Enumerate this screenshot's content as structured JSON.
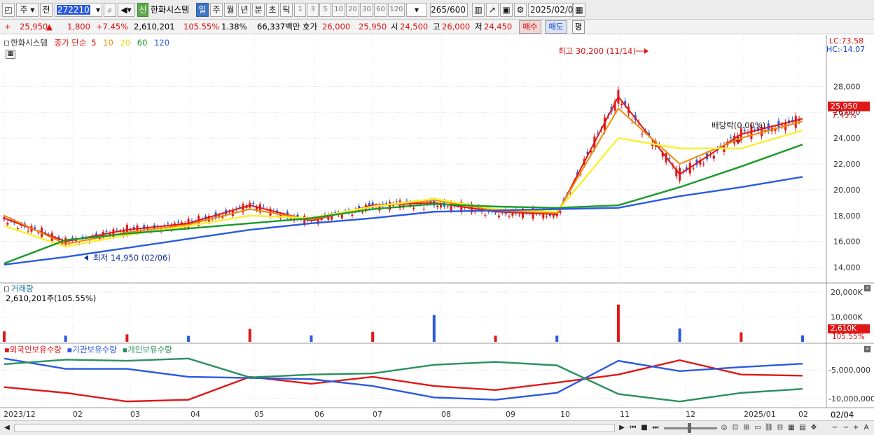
{
  "toolbar": {
    "market_type": "주",
    "market_scope": "전",
    "code": "272210",
    "stock_name": "한화시스템",
    "period_tabs": [
      "일",
      "주",
      "월",
      "년",
      "분",
      "초",
      "틱"
    ],
    "active_period": "일",
    "intervals": [
      "1",
      "3",
      "5",
      "10",
      "20",
      "30",
      "60",
      "120"
    ],
    "count": "265",
    "count_max": "/600",
    "date": "2025/02/04",
    "new_badge": "신"
  },
  "quote": {
    "price": "25,950",
    "price_arrow": "▲",
    "change": "1,800",
    "change_pct": "+7.45%",
    "volume": "2,610,201",
    "volume_ratio": "105.55%",
    "turnover": "1.38%",
    "amount": "66,337백만",
    "ask_label": "호가",
    "ask1": "26,000",
    "ask2": "25,950",
    "open_label": "시",
    "open": "24,500",
    "high_label": "고",
    "high": "26,000",
    "low_label": "저",
    "low": "24,450",
    "buy_button": "매수",
    "sell_button": "매도",
    "eval_button": "평"
  },
  "price_panel": {
    "stock_label": "한화시스템",
    "ma_label": "종가 단순",
    "ma_periods": [
      "5",
      "10",
      "20",
      "60",
      "120"
    ],
    "ma_colors": [
      "#e01818",
      "#f08a00",
      "#f8f030",
      "#1a9a2a",
      "#2a5ae0"
    ],
    "lc": "LC:73.58",
    "hc": "HC:-14.07",
    "high_marker": "최고 30,200 (11/14)",
    "low_marker": "최저 14,950 (02/06)",
    "dividend_marker": "배당락(0.00%)",
    "last_price_tag": "25,950",
    "last_pct_tag": "7.45%"
  },
  "volume_panel": {
    "title": "거래량",
    "value_text": "2,610,201주(105.55%)",
    "last_tag": "2,610K",
    "last_pct": "105.55%"
  },
  "holding_panel": {
    "series": [
      {
        "name": "외국인보유수량",
        "color": "#e01818"
      },
      {
        "name": "기관보유수량",
        "color": "#2a5ae0"
      },
      {
        "name": "개인보유수량",
        "color": "#2a9060"
      }
    ]
  },
  "x_axis": {
    "labels": [
      "2023/12",
      "02",
      "03",
      "04",
      "05",
      "06",
      "07",
      "08",
      "09",
      "10",
      "11",
      "12",
      "2025/01",
      "02"
    ],
    "right_label": "02/04"
  },
  "chart_data": [
    {
      "type": "line",
      "title": "한화시스템",
      "ylim": [
        13000,
        31000
      ],
      "y_ticks": [
        14000,
        16000,
        18000,
        20000,
        22000,
        24000,
        26000,
        28000
      ],
      "y_tick_labels": [
        "14,000",
        "16,000",
        "18,000",
        "20,000",
        "22,000",
        "24,000",
        "26,000",
        "28,000"
      ],
      "x": [
        "2023/12",
        "02",
        "03",
        "04",
        "05",
        "06",
        "07",
        "08",
        "09",
        "10",
        "11",
        "12",
        "2025/01",
        "02"
      ],
      "series": [
        {
          "name": "5",
          "values": [
            17800,
            16000,
            16900,
            17400,
            18800,
            17600,
            18800,
            19000,
            18300,
            18100,
            27200,
            21200,
            24300,
            25500
          ]
        },
        {
          "name": "10",
          "values": [
            18000,
            15800,
            16700,
            17300,
            18500,
            17700,
            18700,
            19200,
            18400,
            18200,
            26300,
            22000,
            24000,
            25300
          ]
        },
        {
          "name": "20",
          "values": [
            17200,
            15600,
            16500,
            17200,
            18000,
            17800,
            18700,
            19300,
            18500,
            18300,
            24000,
            23200,
            23200,
            24600
          ]
        },
        {
          "name": "60",
          "values": [
            14300,
            16100,
            16600,
            17000,
            17400,
            17800,
            18500,
            18900,
            18700,
            18600,
            18800,
            20200,
            21800,
            23500
          ]
        },
        {
          "name": "120",
          "values": [
            14200,
            14800,
            15500,
            16200,
            16900,
            17400,
            17800,
            18300,
            18400,
            18500,
            18600,
            19500,
            20200,
            21000
          ]
        }
      ]
    },
    {
      "type": "bar",
      "title": "거래량",
      "ylim": [
        0,
        22000
      ],
      "y_ticks": [
        10000,
        20000
      ],
      "y_tick_labels": [
        "10,000K",
        "20,000K"
      ],
      "x": [
        "2023/12",
        "02",
        "03",
        "04",
        "05",
        "06",
        "07",
        "08",
        "09",
        "10",
        "11",
        "12",
        "2025/01",
        "02"
      ],
      "values": [
        4200,
        2500,
        3000,
        2400,
        5200,
        2600,
        4000,
        10800,
        2500,
        2500,
        15000,
        5400,
        3800,
        2610
      ]
    },
    {
      "type": "line",
      "title": "보유수량",
      "y_ticks": [
        -5000000,
        -10000000
      ],
      "y_tick_labels": [
        "-5,000,000",
        "-10,000,000"
      ],
      "x": [
        "2023/12",
        "02",
        "03",
        "04",
        "05",
        "06",
        "07",
        "08",
        "09",
        "10",
        "11",
        "12",
        "2025/01",
        "02"
      ],
      "series": [
        {
          "name": "외국인보유수량",
          "values": [
            -8000000,
            -9000000,
            -10500000,
            -10200000,
            -6200000,
            -7400000,
            -6200000,
            -7800000,
            -8500000,
            -7200000,
            -5800000,
            -3300000,
            -5800000,
            -6000000
          ]
        },
        {
          "name": "기관보유수량",
          "values": [
            -3000000,
            -4800000,
            -4800000,
            -6200000,
            -6400000,
            -6600000,
            -7800000,
            -9800000,
            -10200000,
            -9000000,
            -3400000,
            -5200000,
            -4500000,
            -3900000
          ]
        },
        {
          "name": "개인보유수량",
          "values": [
            -4000000,
            -3200000,
            -3400000,
            -3000000,
            -6300000,
            -5800000,
            -5600000,
            -4100000,
            -3600000,
            -4200000,
            -9200000,
            -10500000,
            -9000000,
            -8300000
          ]
        }
      ]
    }
  ]
}
